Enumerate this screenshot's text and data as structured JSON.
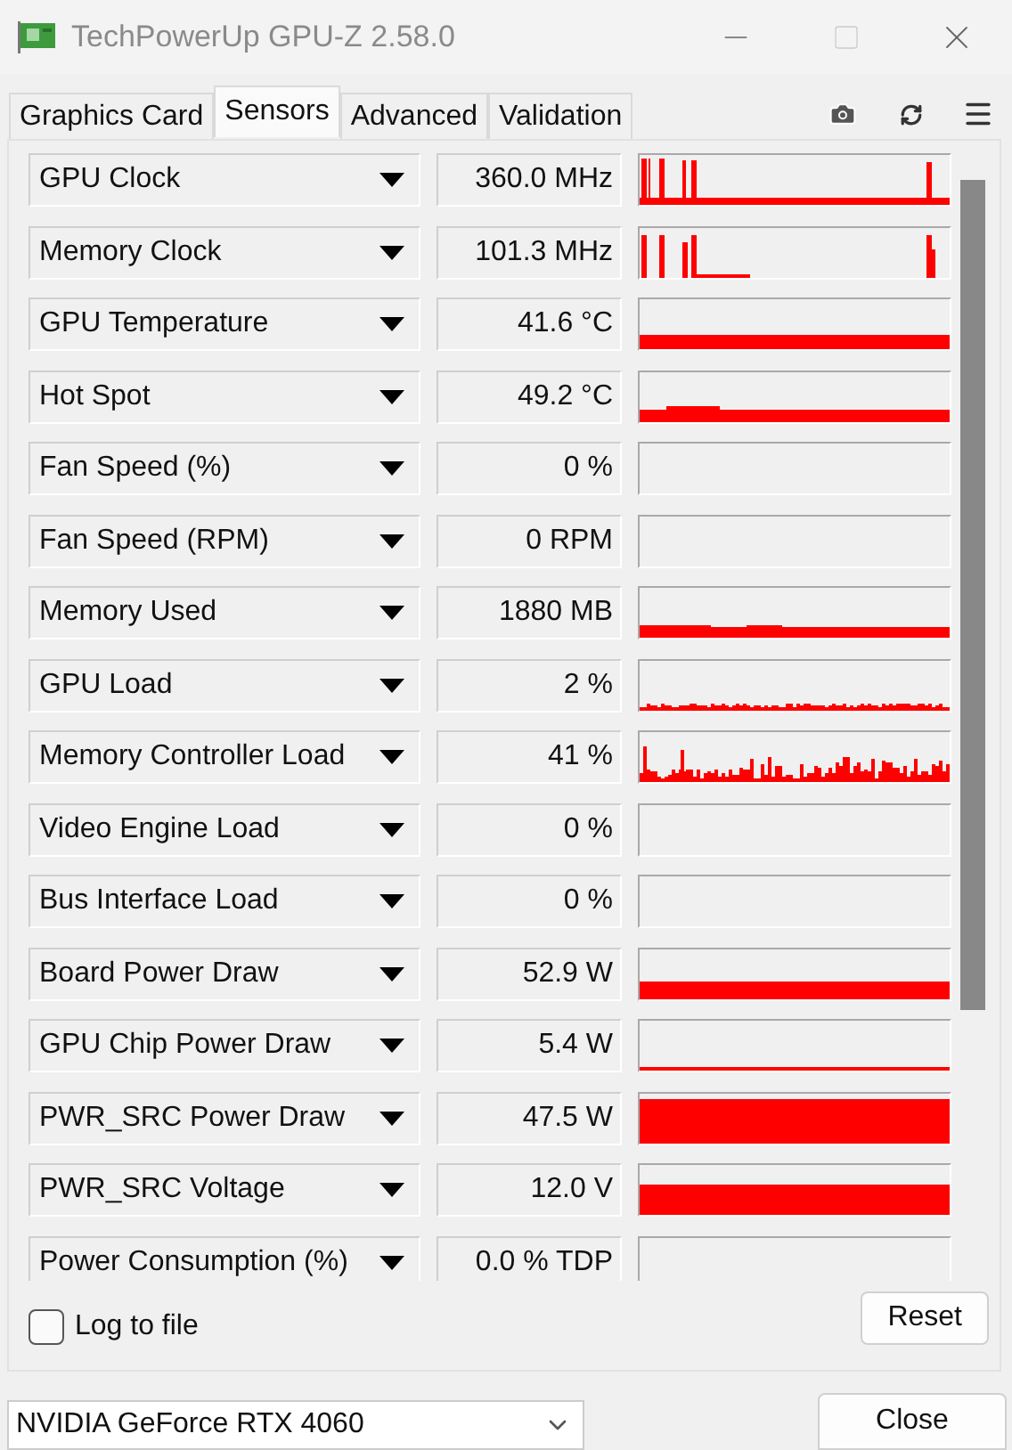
{
  "window": {
    "title": "TechPowerUp GPU-Z 2.58.0"
  },
  "tabs": [
    {
      "label": "Graphics Card",
      "selected": false
    },
    {
      "label": "Sensors",
      "selected": true
    },
    {
      "label": "Advanced",
      "selected": false
    },
    {
      "label": "Validation",
      "selected": false
    }
  ],
  "sensors": [
    {
      "name": "GPU Clock",
      "value": "360.0 MHz"
    },
    {
      "name": "Memory Clock",
      "value": "101.3 MHz"
    },
    {
      "name": "GPU Temperature",
      "value": "41.6 °C"
    },
    {
      "name": "Hot Spot",
      "value": "49.2 °C"
    },
    {
      "name": "Fan Speed (%)",
      "value": "0 %"
    },
    {
      "name": "Fan Speed (RPM)",
      "value": "0 RPM"
    },
    {
      "name": "Memory Used",
      "value": "1880 MB"
    },
    {
      "name": "GPU Load",
      "value": "2 %"
    },
    {
      "name": "Memory Controller Load",
      "value": "41 %"
    },
    {
      "name": "Video Engine Load",
      "value": "0 %"
    },
    {
      "name": "Bus Interface Load",
      "value": "0 %"
    },
    {
      "name": "Board Power Draw",
      "value": "52.9 W"
    },
    {
      "name": "GPU Chip Power Draw",
      "value": "5.4 W"
    },
    {
      "name": "PWR_SRC Power Draw",
      "value": "47.5 W"
    },
    {
      "name": "PWR_SRC Voltage",
      "value": "12.0 V"
    },
    {
      "name": "Power Consumption (%)",
      "value": "0.0 % TDP"
    }
  ],
  "log_to_file": {
    "label": "Log to file",
    "checked": false
  },
  "reset_button": "Reset",
  "gpu_select": {
    "value": "NVIDIA GeForce RTX 4060"
  },
  "close_button": "Close"
}
